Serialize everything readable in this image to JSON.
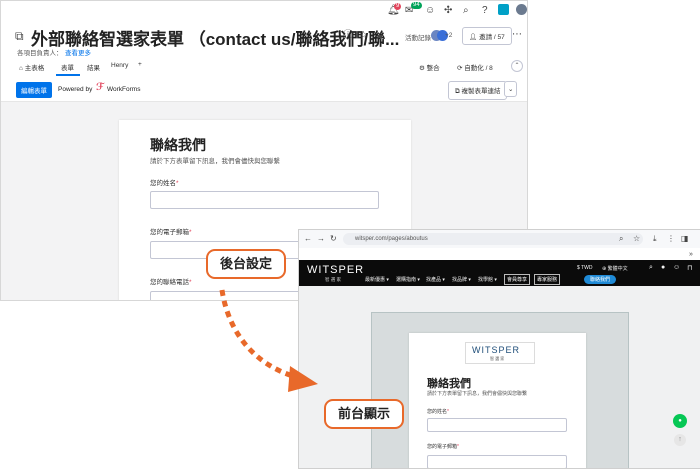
{
  "back": {
    "topbar": {
      "notif_badge": "9",
      "inbox_badge": "94"
    },
    "title": "外部聯絡智選家表單 （contact us/聯絡我們/聯...",
    "owner_label": "各項目負責人：",
    "owner_link": "查看更多",
    "activity_label": "活動記錄",
    "avatars_more": "+2",
    "invite_label": "邀請 / 57",
    "tabs": [
      "主表格",
      "表單",
      "結果",
      "Henry"
    ],
    "add_tab": "+",
    "integrate_label": "整合",
    "automate_label": "自動化 / 8",
    "edit_form_button": "編輯表單",
    "powered_by": "Powered by",
    "workforms": "WorkForms",
    "copy_link_button": "複製表單連結",
    "form": {
      "title": "聯絡我們",
      "subtitle": "請於下方表單留下訊息，我們會儘快與您聯繫",
      "fields": [
        {
          "label": "您的姓名",
          "req": "*"
        },
        {
          "label": "您的電子郵箱",
          "req": "*"
        },
        {
          "label": "您的聯絡電話",
          "req": "*"
        }
      ]
    }
  },
  "front": {
    "url": "witsper.com/pages/aboutus",
    "logo_main": "WITSPER",
    "logo_sub": "智 選 家",
    "currency": "$ TWD",
    "language": "繁體中文",
    "nav_items": [
      "最新優惠 ▾",
      "選購指南 ▾",
      "找產品 ▾",
      "找品牌 ▾",
      "找學館 ▾"
    ],
    "nav_box1": "會員尊享",
    "nav_box2": "專家服務",
    "nav_pill": "聯絡我們",
    "form": {
      "logo_main": "WITSPER",
      "logo_sub": "智 選 家",
      "title": "聯絡我們",
      "subtitle": "請於下方表單留下訊息，我們會儘快與您聯繫",
      "fields": [
        {
          "label": "您的姓名",
          "req": "*"
        },
        {
          "label": "您的電子郵箱",
          "req": "*"
        }
      ]
    }
  },
  "callouts": {
    "backend": "後台設定",
    "frontend": "前台顯示"
  },
  "colors": {
    "accent": "#0073ea",
    "arrow": "#e8692a",
    "line_green": "#06c755"
  }
}
